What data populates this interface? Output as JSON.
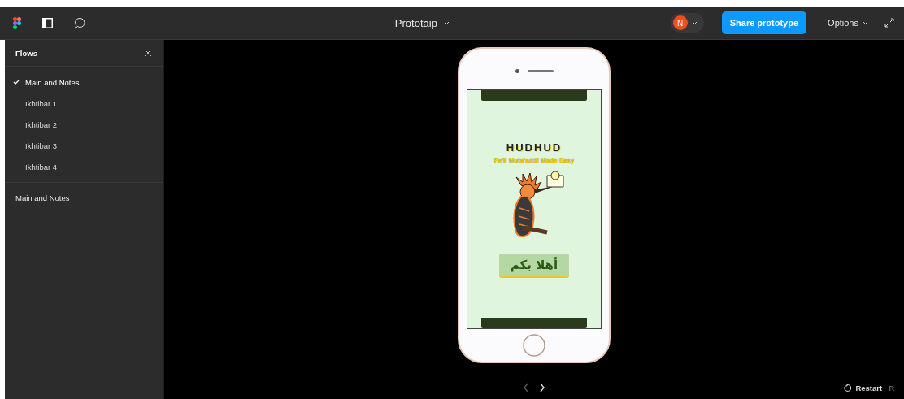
{
  "toolbar": {
    "title": "Prototaip",
    "avatar": "N",
    "share_button": "Share prototype",
    "options": "Options"
  },
  "sidebar": {
    "title": "Flows",
    "flows": [
      {
        "label": "Main and Notes",
        "selected": true
      },
      {
        "label": "Ikhtibar 1",
        "selected": false
      },
      {
        "label": "Ikhtibar 2",
        "selected": false
      },
      {
        "label": "Ikhtibar 3",
        "selected": false
      },
      {
        "label": "Ikhtibar 4",
        "selected": false
      }
    ],
    "current_flow": "Main and Notes"
  },
  "phone": {
    "app_title": "HUDHUD",
    "tagline": "Fe'il Muta'addi Made Easy",
    "welcome_button": "أهلا بكم"
  },
  "footer": {
    "nav": [
      {
        "kind": "prev",
        "disabled": true
      },
      {
        "kind": "next",
        "disabled": false
      }
    ],
    "restart": "Restart",
    "shortcut": "R"
  }
}
